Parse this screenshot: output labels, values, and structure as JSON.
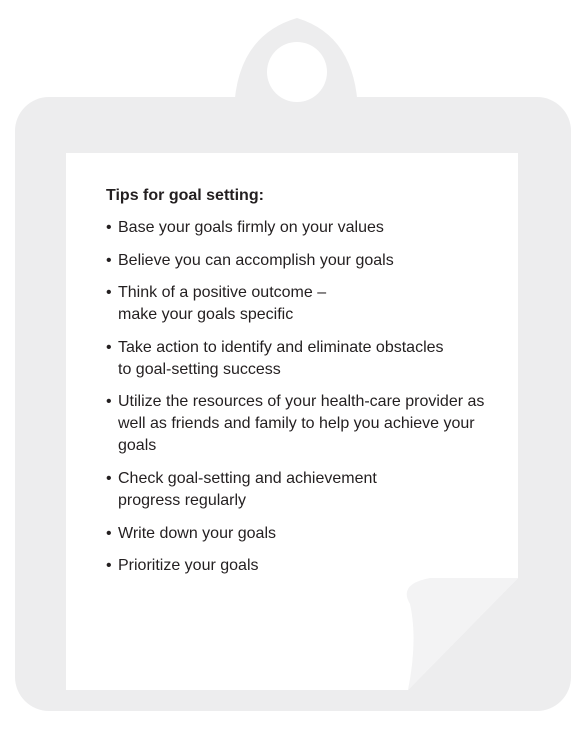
{
  "card": {
    "heading": "Tips for goal setting:",
    "bullet_symbol": "•",
    "tips": [
      "Base your goals firmly on your values",
      "Believe you can accomplish your goals",
      "Think of a positive outcome – make your goals specific",
      "Take action to identify and eliminate obstacles to goal-setting success",
      "Utilize the resources of your health-care provider as well as friends and family to help you achieve your goals",
      "Check goal-setting and achievement progress regularly",
      "Write down your goals",
      "Prioritize your goals"
    ]
  },
  "colors": {
    "board": "#ededee",
    "paper": "#ffffff",
    "text": "#231f20"
  },
  "icons": {
    "clipboard": "clipboard-icon",
    "clip_hole": "clip-hole-icon",
    "page_curl": "page-curl-icon"
  }
}
